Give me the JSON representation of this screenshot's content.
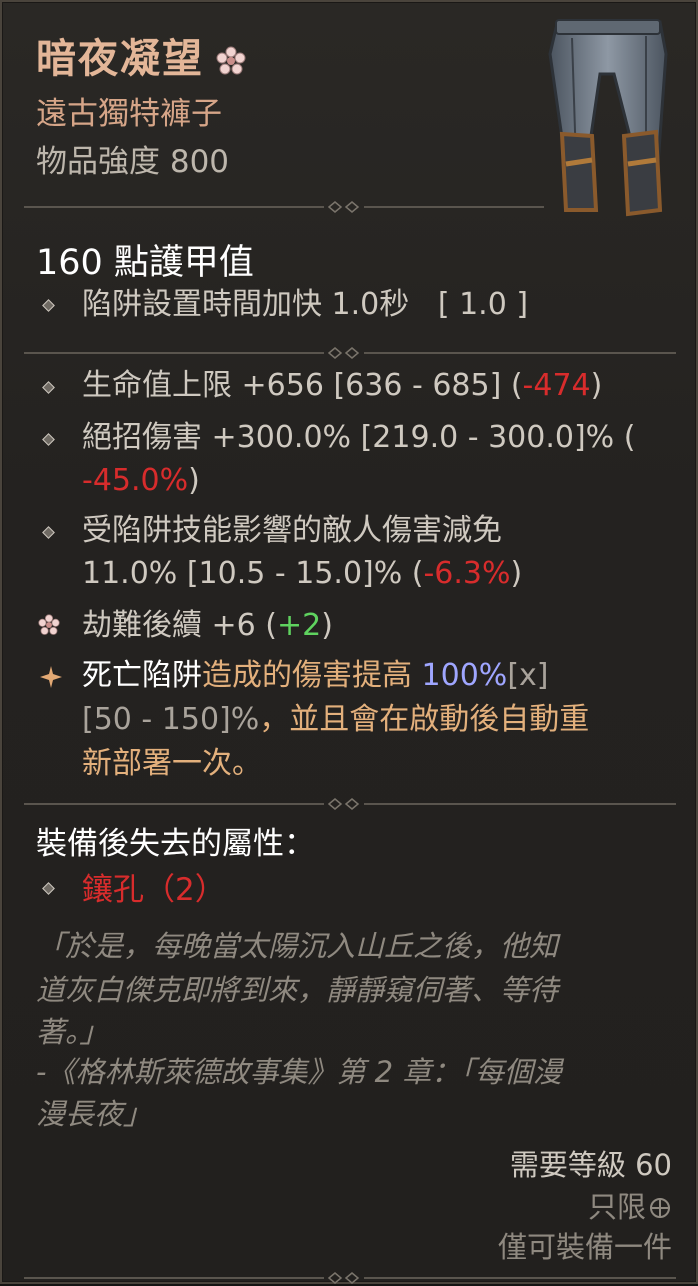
{
  "item": {
    "name": "暗夜凝望",
    "type": "遠古獨特褲子",
    "power": "物品強度 800",
    "icon": "unique-flower-icon",
    "image": "pants-item-image"
  },
  "armor": "160 點護甲值",
  "implicit": [
    {
      "text": "陷阱設置時間加快 1.0秒",
      "range": "[ 1.0 ]"
    }
  ],
  "affixes": [
    {
      "l1": "生命值上限 +656 [636 - 685] (",
      "diff": "-474",
      "tail": ")"
    },
    {
      "l1a": "絕招傷害 +300.0% [219.0 - 300.0]% (",
      "l2diff": "-45.0%",
      "l2tail": ")"
    },
    {
      "l1": "受陷阱技能影響的敵人傷害減免",
      "l2": "11.0% [10.5 - 15.0]% (",
      "diff": "-6.3%",
      "tail": ")"
    },
    {
      "l1": "劫難後續 +6 (",
      "gain": "+2",
      "tail": ")"
    }
  ],
  "unique_power": {
    "p1": "死亡陷阱",
    "p2": "造成的傷害提高 ",
    "p3": "100%",
    "p4": "[x]",
    "l2a": "[50 - 150]%",
    "l2b": "，並且會在啟動後自動重",
    "l3": "新部署一次。"
  },
  "lost": {
    "heading": "裝備後失去的屬性：",
    "socket": "鑲孔（2）"
  },
  "flavor": {
    "l1": "「於是，每晚當太陽沉入山丘之後，他知",
    "l2": "道灰白傑克即將到來，靜靜窺伺著、等待",
    "l3": "著。」",
    "l4": "-《格林斯萊德故事集》第 2 章：「每個漫",
    "l5": "漫長夜」"
  },
  "requirements": {
    "level": "需要等級 60",
    "unique": "只限",
    "equip": "僅可裝備一件"
  },
  "colors": {
    "title": "#e3b698",
    "red": "#d82c2c",
    "green": "#5fd35f",
    "blue": "#9fa6ff",
    "orange": "#e3b07c"
  }
}
